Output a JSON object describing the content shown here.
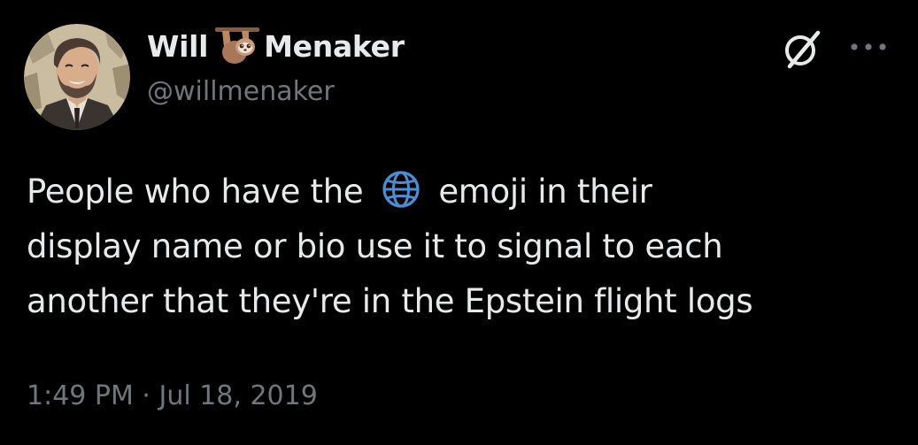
{
  "author": {
    "name_first": "Will",
    "name_last": "Menaker",
    "name_emoji": "sloth-icon",
    "handle": "@willmenaker",
    "avatar": "avatar"
  },
  "header_actions": {
    "grok_icon": "grok-icon",
    "more_icon": "more-icon"
  },
  "tweet": {
    "line1_before": "People who have the",
    "line1_emoji": "globe-icon",
    "line1_after": "emoji in their",
    "line2": "display name or bio use it to signal to each",
    "line3": "another that they're in the Epstein flight logs",
    "timestamp": "1:49 PM · Jul 18, 2019"
  },
  "colors": {
    "background": "#000000",
    "primary_text": "#e7e9ea",
    "secondary_text": "#71767b",
    "globe_blue": "#4a8fd6"
  }
}
